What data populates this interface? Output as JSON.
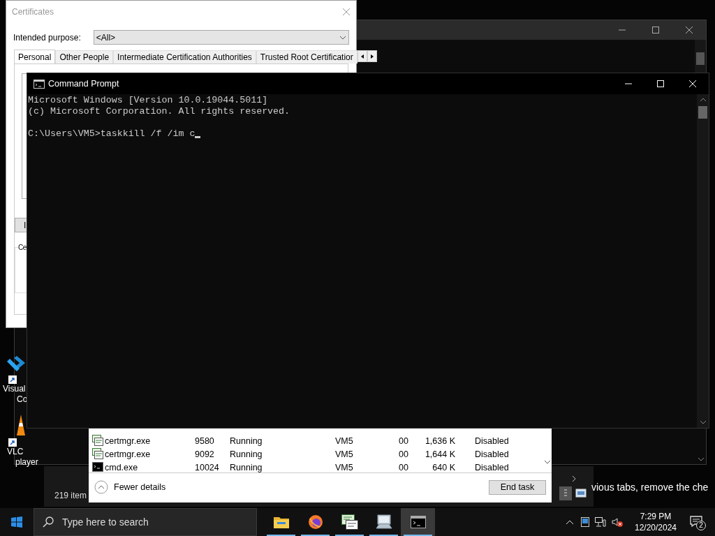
{
  "desktop_icons": [
    {
      "kind": "code",
      "lines": [
        "Visual",
        "Co"
      ]
    },
    {
      "kind": "cone",
      "lines": [
        "VLC",
        "player"
      ]
    }
  ],
  "explorer": {
    "status": "219 item"
  },
  "background_text": "vious tabs, remove the che",
  "certificates": {
    "title": "Certificates",
    "purpose_label": "Intended purpose:",
    "purpose_value": "<All>",
    "tabs": [
      {
        "label": "Personal",
        "selected": true
      },
      {
        "label": "Other People",
        "selected": false
      },
      {
        "label": "Intermediate Certification Authorities",
        "selected": false
      },
      {
        "label": "Trusted Root Certificatior",
        "selected": false
      }
    ],
    "button": "I",
    "group_label": "Ce"
  },
  "task_manager": {
    "rows": [
      {
        "kind": "certmgr",
        "name": "certmgr.exe",
        "pid": "9580",
        "status": "Running",
        "user": "VM5",
        "cpu": "00",
        "memory": "1,636 K",
        "uac": "Disabled"
      },
      {
        "kind": "certmgr",
        "name": "certmgr.exe",
        "pid": "9092",
        "status": "Running",
        "user": "VM5",
        "cpu": "00",
        "memory": "1,644 K",
        "uac": "Disabled"
      },
      {
        "kind": "cmd",
        "name": "cmd.exe",
        "pid": "10024",
        "status": "Running",
        "user": "VM5",
        "cpu": "00",
        "memory": "640 K",
        "uac": "Disabled"
      }
    ],
    "fewer_details": "Fewer details",
    "end_task": "End task"
  },
  "command_prompt": {
    "title": "Command Prompt",
    "lines": [
      "Microsoft Windows [Version 10.0.19044.5011]",
      "(c) Microsoft Corporation. All rights reserved."
    ],
    "prompt": "C:\\Users\\VM5>taskkill /f /im c"
  },
  "taskbar": {
    "search_placeholder": "Type here to search",
    "apps": [
      {
        "kind": "folder",
        "active": false
      },
      {
        "kind": "browser",
        "active": false
      },
      {
        "kind": "certificate",
        "active": false
      },
      {
        "kind": "computer",
        "active": false
      },
      {
        "kind": "console",
        "active": true
      }
    ],
    "time": "7:29 PM",
    "date": "12/20/2024",
    "notifications": "2"
  }
}
